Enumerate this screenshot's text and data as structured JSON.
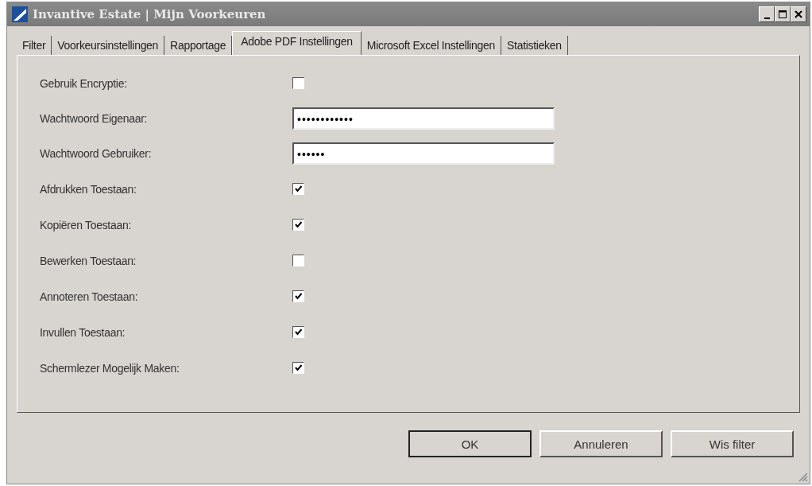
{
  "window": {
    "title": "Invantive Estate | Mijn Voorkeuren"
  },
  "tabs": [
    {
      "label": "Filter",
      "selected": false
    },
    {
      "label": "Voorkeursinstellingen",
      "selected": false
    },
    {
      "label": "Rapportage",
      "selected": false
    },
    {
      "label": "Adobe PDF Instellingen",
      "selected": true
    },
    {
      "label": "Microsoft Excel Instellingen",
      "selected": false
    },
    {
      "label": "Statistieken",
      "selected": false
    }
  ],
  "rows": [
    {
      "kind": "checkbox",
      "label": "Gebruik Encryptie:",
      "checked": false
    },
    {
      "kind": "password",
      "label": "Wachtwoord Eigenaar:",
      "value": "••••••••••••"
    },
    {
      "kind": "password",
      "label": "Wachtwoord Gebruiker:",
      "value": "••••••"
    },
    {
      "kind": "checkbox",
      "label": "Afdrukken Toestaan:",
      "checked": true
    },
    {
      "kind": "checkbox",
      "label": "Kopiëren Toestaan:",
      "checked": true
    },
    {
      "kind": "checkbox",
      "label": "Bewerken Toestaan:",
      "checked": false
    },
    {
      "kind": "checkbox",
      "label": "Annoteren Toestaan:",
      "checked": true
    },
    {
      "kind": "checkbox",
      "label": "Invullen Toestaan:",
      "checked": true
    },
    {
      "kind": "checkbox",
      "label": "Schermlezer Mogelijk Maken:",
      "checked": true
    }
  ],
  "buttons": [
    {
      "label": "OK",
      "default": true
    },
    {
      "label": "Annuleren",
      "default": false
    },
    {
      "label": "Wis filter",
      "default": false
    }
  ]
}
